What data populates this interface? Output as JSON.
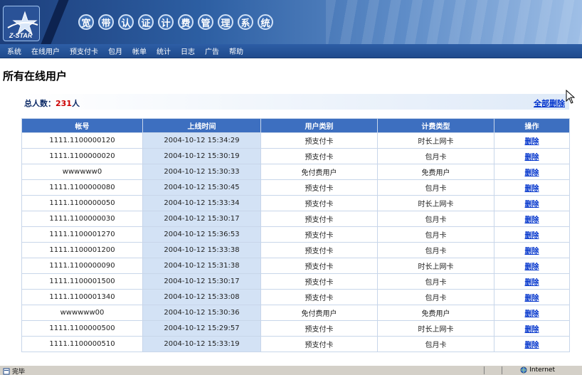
{
  "app": {
    "logo_text": "Z-STAR",
    "title_chars": [
      "宽",
      "带",
      "认",
      "证",
      "计",
      "费",
      "管",
      "理",
      "系",
      "统"
    ]
  },
  "nav": {
    "items": [
      "系统",
      "在线用户",
      "预支付卡",
      "包月",
      "帐单",
      "统计",
      "日志",
      "广告",
      "帮助"
    ]
  },
  "page": {
    "title": "所有在线用户",
    "total_label": "总人数：",
    "total_count": "231",
    "total_unit": "人",
    "delete_all": "全部删除"
  },
  "table": {
    "headers": [
      "帐号",
      "上线时间",
      "用户类别",
      "计费类型",
      "操作"
    ],
    "rows": [
      [
        "1111.1100000120",
        "2004-10-12 15:34:29",
        "预支付卡",
        "时长上网卡",
        "删除"
      ],
      [
        "1111.1100000020",
        "2004-10-12 15:30:19",
        "预支付卡",
        "包月卡",
        "删除"
      ],
      [
        "wwwwww0",
        "2004-10-12 15:30:33",
        "免付费用户",
        "免费用户",
        "删除"
      ],
      [
        "1111.1100000080",
        "2004-10-12 15:30:45",
        "预支付卡",
        "包月卡",
        "删除"
      ],
      [
        "1111.1100000050",
        "2004-10-12 15:33:34",
        "预支付卡",
        "时长上网卡",
        "删除"
      ],
      [
        "1111.1100000030",
        "2004-10-12 15:30:17",
        "预支付卡",
        "包月卡",
        "删除"
      ],
      [
        "1111.1100001270",
        "2004-10-12 15:36:53",
        "预支付卡",
        "包月卡",
        "删除"
      ],
      [
        "1111.1100001200",
        "2004-10-12 15:33:38",
        "预支付卡",
        "包月卡",
        "删除"
      ],
      [
        "1111.1100000090",
        "2004-10-12 15:31:38",
        "预支付卡",
        "时长上网卡",
        "删除"
      ],
      [
        "1111.1100001500",
        "2004-10-12 15:30:17",
        "预支付卡",
        "包月卡",
        "删除"
      ],
      [
        "1111.1100001340",
        "2004-10-12 15:33:08",
        "预支付卡",
        "包月卡",
        "删除"
      ],
      [
        "wwwwww00",
        "2004-10-12 15:30:36",
        "免付费用户",
        "免费用户",
        "删除"
      ],
      [
        "1111.1100000500",
        "2004-10-12 15:29:57",
        "预支付卡",
        "时长上网卡",
        "删除"
      ],
      [
        "1111.1100000510",
        "2004-10-12 15:33:19",
        "预支付卡",
        "包月卡",
        "删除"
      ]
    ]
  },
  "status": {
    "left_text": "完毕",
    "right_text": "Internet"
  }
}
